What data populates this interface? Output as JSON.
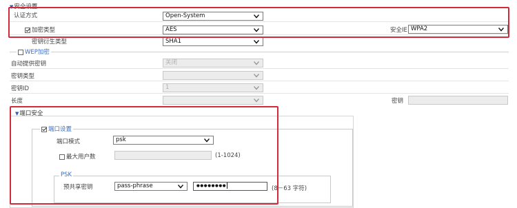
{
  "security": {
    "title": "安全设置",
    "auth_label": "认证方式",
    "auth_value": "Open-System",
    "encrypt_label": "加密类型",
    "encrypt_value": "AES",
    "security_ie_label": "安全IE",
    "security_ie_value": "WPA2",
    "key_gen_label": "密钥衍生类型",
    "key_gen_value": "SHA1"
  },
  "wep": {
    "legend": "WEP加密",
    "auto_key_label": "自动提供密钥",
    "auto_key_value": "关闭",
    "key_type_label": "密钥类型",
    "key_id_label": "密钥ID",
    "key_id_value": "1",
    "length_label": "长度",
    "key_label": "密钥"
  },
  "port_security": {
    "title": "端口安全",
    "settings_legend": "端口设置",
    "port_mode_label": "端口模式",
    "port_mode_value": "psk",
    "max_users_label": "最大用户数",
    "max_users_range": "(1-1024)",
    "psk_legend": "PSK",
    "psk_label": "预共享密钥",
    "psk_type_value": "pass-phrase",
    "psk_password_mask": "●●●●●●●●",
    "psk_range": "(8－63 字符)"
  },
  "colors": {
    "highlight": "#d12a3a",
    "accent": "#2a5db0"
  }
}
